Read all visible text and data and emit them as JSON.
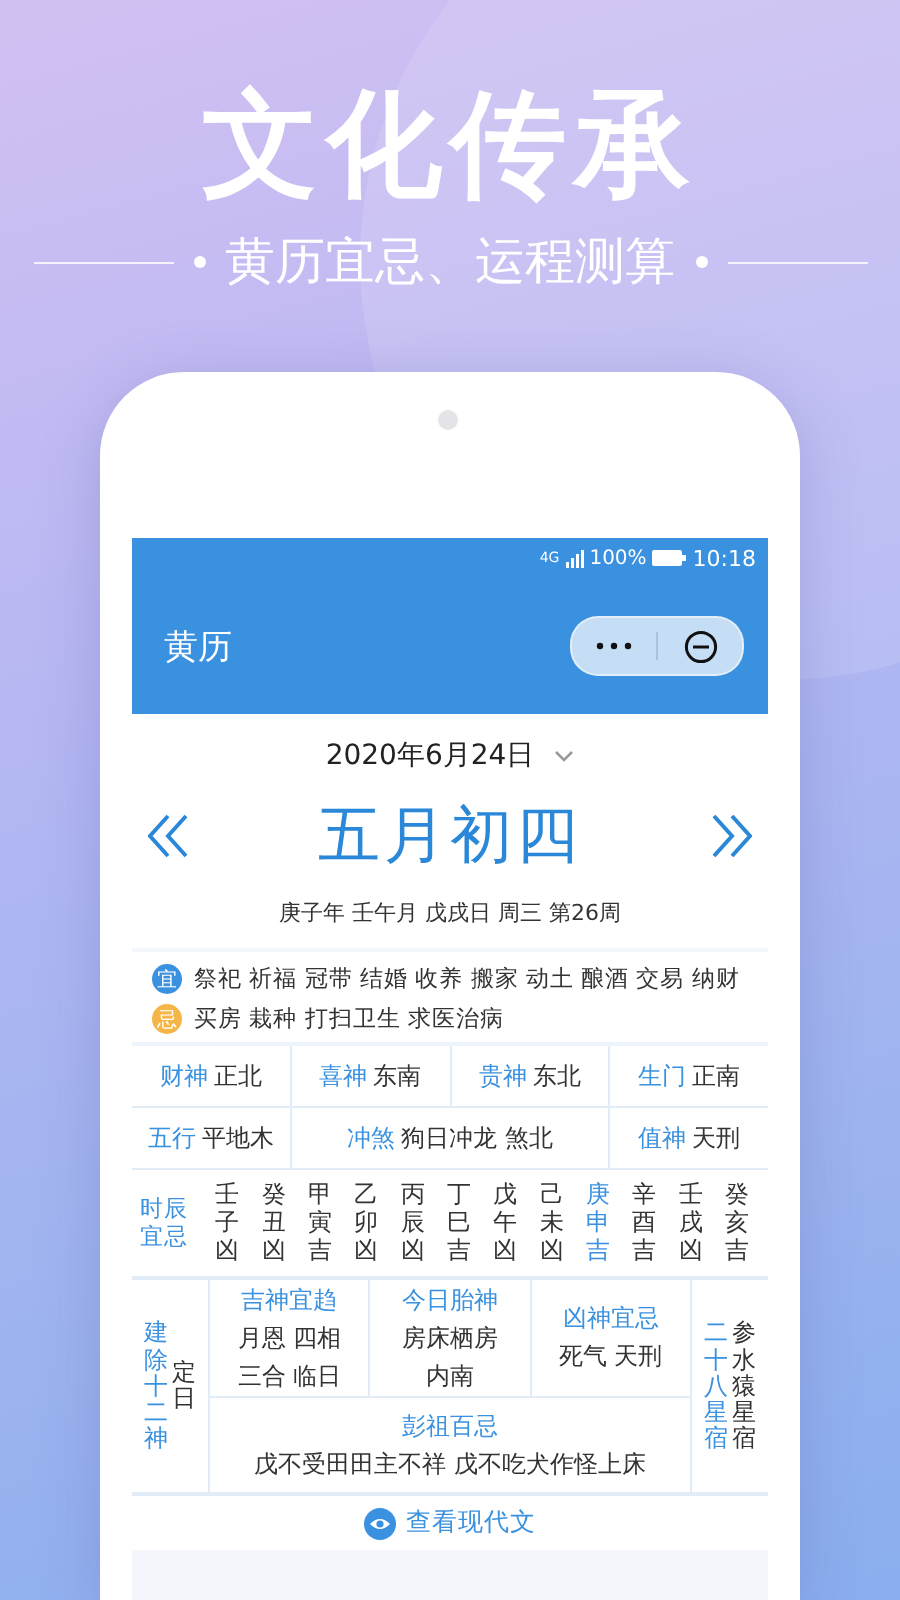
{
  "promo": {
    "title": "文化传承",
    "subtitle": "黄历宜忌、运程测算"
  },
  "status_bar": {
    "network": "4G",
    "battery": "100%",
    "time": "10:18"
  },
  "app_bar": {
    "title": "黄历"
  },
  "date_picker": {
    "value": "2020年6月24日"
  },
  "lunar_date": "五月初四",
  "ganzhi": "庚子年 壬午月 戊戌日 周三 第26周",
  "yi_ji": [
    {
      "kind": "yi",
      "badge": "宜",
      "text": "祭祀 祈福 冠带 结婚 收养 搬家 动土 酿酒 交易 纳财"
    },
    {
      "kind": "ji",
      "badge": "忌",
      "text": "买房 栽种 打扫卫生 求医治病"
    }
  ],
  "gods": [
    {
      "label": "财神",
      "value": "正北"
    },
    {
      "label": "喜神",
      "value": "东南"
    },
    {
      "label": "贵神",
      "value": "东北"
    },
    {
      "label": "生门",
      "value": "正南"
    }
  ],
  "info": [
    {
      "label": "五行",
      "value": "平地木"
    },
    {
      "label": "冲煞",
      "value": "狗日冲龙 煞北"
    },
    {
      "label": "值神",
      "value": "天刑"
    }
  ],
  "hours": {
    "label": "时辰宜忌",
    "items": [
      {
        "text": "壬子凶",
        "selected": false
      },
      {
        "text": "癸丑凶",
        "selected": false
      },
      {
        "text": "甲寅吉",
        "selected": false
      },
      {
        "text": "乙卯凶",
        "selected": false
      },
      {
        "text": "丙辰凶",
        "selected": false
      },
      {
        "text": "丁巳吉",
        "selected": false
      },
      {
        "text": "戊午凶",
        "selected": false
      },
      {
        "text": "己未凶",
        "selected": false
      },
      {
        "text": "庚申吉",
        "selected": true
      },
      {
        "text": "辛酉吉",
        "selected": false
      },
      {
        "text": "壬戌凶",
        "selected": false
      },
      {
        "text": "癸亥吉",
        "selected": false
      }
    ]
  },
  "details": {
    "jianchu": {
      "label": "建除十二神",
      "value": "定日"
    },
    "boxes": [
      {
        "title": "吉神宜趋",
        "lines": [
          "月恩 四相",
          "三合 临日"
        ]
      },
      {
        "title": "今日胎神",
        "lines": [
          "房床栖房",
          "内南"
        ]
      },
      {
        "title": "凶神宜忌",
        "lines": [
          "死气 天刑"
        ]
      }
    ],
    "pengzu": {
      "title": "彭祖百忌",
      "text": "戊不受田田主不祥 戊不吃犬作怪上床"
    },
    "stars": {
      "label": "二十八星宿",
      "value": "参水猿星宿"
    }
  },
  "modern_link": "查看现代文"
}
